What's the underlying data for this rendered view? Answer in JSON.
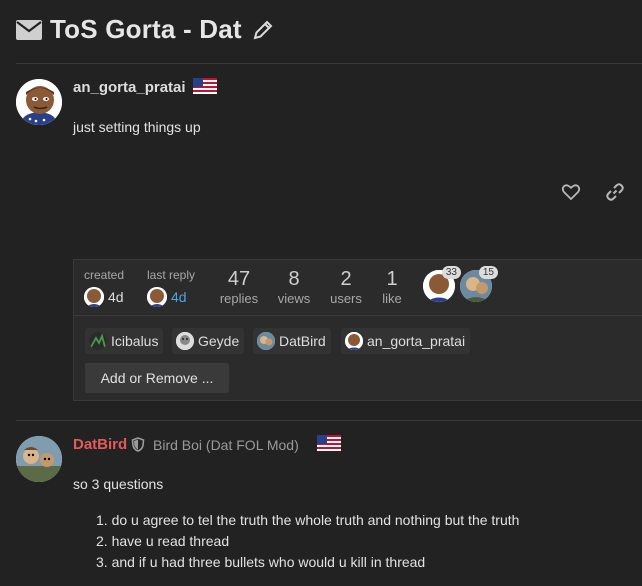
{
  "topic": {
    "title": "ToS Gorta - Dat"
  },
  "post1": {
    "username": "an_gorta_pratai",
    "body": "just setting things up"
  },
  "map": {
    "created_label": "created",
    "created_value": "4d",
    "last_reply_label": "last reply",
    "last_reply_value": "4d",
    "stats": [
      {
        "value": "47",
        "label": "replies"
      },
      {
        "value": "8",
        "label": "views"
      },
      {
        "value": "2",
        "label": "users"
      },
      {
        "value": "1",
        "label": "like"
      }
    ],
    "participants": [
      {
        "count": "33"
      },
      {
        "count": "15"
      }
    ],
    "allowed_users": [
      "Icibalus",
      "Geyde",
      "DatBird",
      "an_gorta_pratai"
    ],
    "add_remove_label": "Add or Remove ..."
  },
  "post2": {
    "username": "DatBird",
    "user_title": "Bird Boi (Dat FOL Mod)",
    "intro": "so 3 questions",
    "list": [
      "do u agree to tel the truth the whole truth and nothing but the truth",
      "have u read thread",
      "and if u had three bullets who would u kill in thread"
    ]
  },
  "colors": {
    "background": "#222222",
    "link_blue": "#4fa3e0",
    "moderator_red": "#e45a5a"
  }
}
